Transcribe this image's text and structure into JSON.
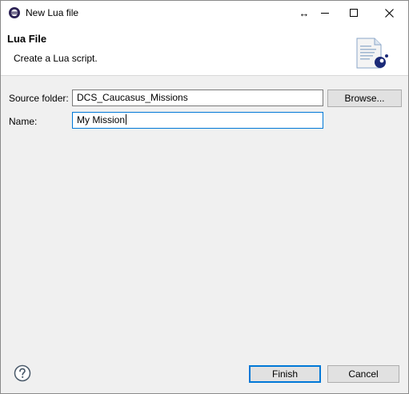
{
  "window": {
    "title": "New Lua file",
    "controls": {
      "resize_glyph": "↔",
      "minimize_glyph": "—",
      "maximize_glyph": "☐",
      "close_glyph": "✕"
    }
  },
  "header": {
    "title": "Lua File",
    "description": "Create a Lua script."
  },
  "form": {
    "source_folder": {
      "label": "Source folder:",
      "value": "DCS_Caucasus_Missions"
    },
    "name": {
      "label": "Name:",
      "value": "My Mission"
    },
    "browse_label": "Browse..."
  },
  "footer": {
    "finish_label": "Finish",
    "cancel_label": "Cancel"
  },
  "icons": {
    "app": "eclipse-icon",
    "wizard": "lua-file-wizard-icon",
    "help": "help-icon"
  }
}
